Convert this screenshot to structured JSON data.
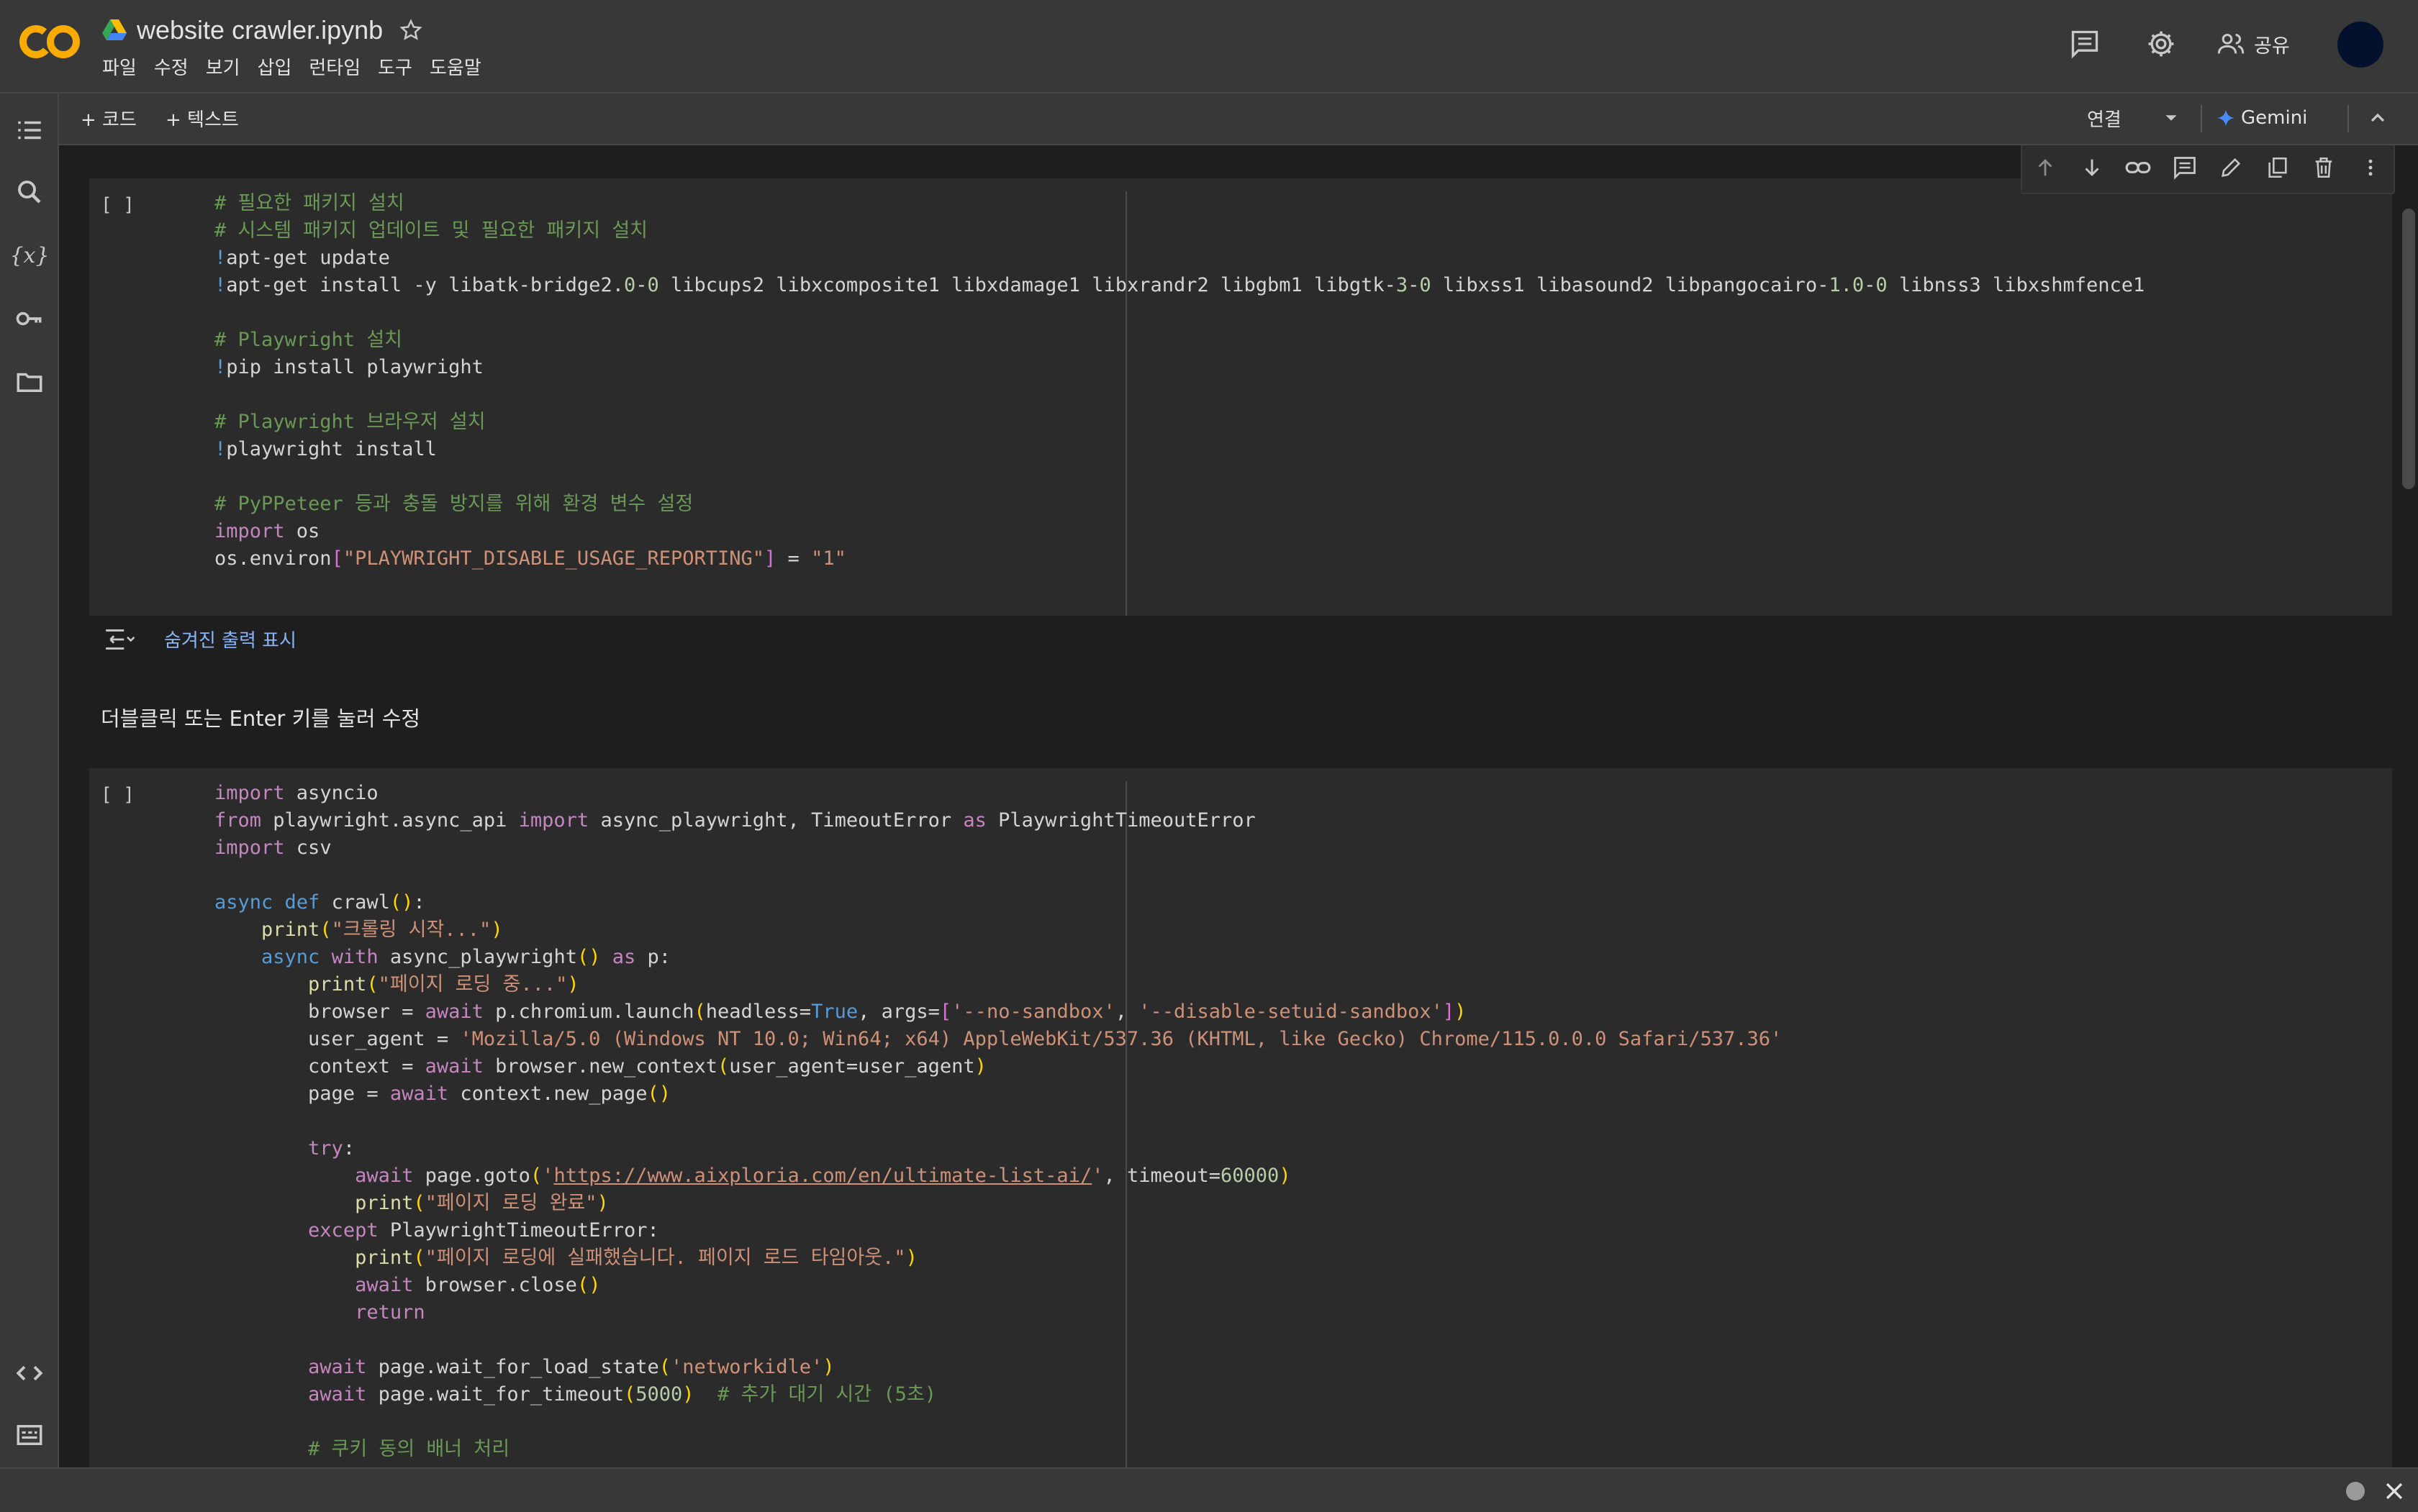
{
  "app": {
    "notebook_title": "website crawler.ipynb",
    "menu": [
      "파일",
      "수정",
      "보기",
      "삽입",
      "런타임",
      "도구",
      "도움말"
    ],
    "share_label": "공유",
    "colors": {
      "accent_orange": "#f9ab00",
      "link_blue": "#8ab4f8"
    }
  },
  "toolbar": {
    "add_code_label": "+ 코드",
    "add_text_label": "+ 텍스트",
    "connect_label": "연결",
    "gemini_label": "Gemini"
  },
  "cell1": {
    "bracket": "[ ]",
    "lines": [
      "# 필요한 패키지 설치",
      "# 시스템 패키지 업데이트 및 필요한 패키지 설치",
      "!apt-get update",
      "!apt-get install -y libatk-bridge2.0-0 libcups2 libxcomposite1 libxdamage1 libxrandr2 libgbm1 libgtk-3-0 libxss1 libasound2 libpangocairo-1.0-0 libnss3 libxshmfence1",
      "",
      "# Playwright 설치",
      "!pip install playwright",
      "",
      "# Playwright 브라우저 설치",
      "!playwright install",
      "",
      "# PyPPeteer 등과 충돌 방지를 위해 환경 변수 설정",
      "import os",
      "os.environ[\"PLAYWRIGHT_DISABLE_USAGE_REPORTING\"] = \"1\""
    ]
  },
  "hidden_output_label": "숨겨진 출력 표시",
  "text_cell_hint": "더블클릭 또는 Enter 키를 눌러 수정",
  "cell2": {
    "bracket": "[ ]",
    "lines": [
      "import asyncio",
      "from playwright.async_api import async_playwright, TimeoutError as PlaywrightTimeoutError",
      "import csv",
      "",
      "async def crawl():",
      "    print(\"크롤링 시작...\")",
      "    async with async_playwright() as p:",
      "        print(\"페이지 로딩 중...\")",
      "        browser = await p.chromium.launch(headless=True, args=['--no-sandbox', '--disable-setuid-sandbox'])",
      "        user_agent = 'Mozilla/5.0 (Windows NT 10.0; Win64; x64) AppleWebKit/537.36 (KHTML, like Gecko) Chrome/115.0.0.0 Safari/537.36'",
      "        context = await browser.new_context(user_agent=user_agent)",
      "        page = await context.new_page()",
      "",
      "        try:",
      "            await page.goto('https://www.aixploria.com/en/ultimate-list-ai/', timeout=60000)",
      "            print(\"페이지 로딩 완료\")",
      "        except PlaywrightTimeoutError:",
      "            print(\"페이지 로딩에 실패했습니다. 페이지 로드 타임아웃.\")",
      "            await browser.close()",
      "            return",
      "",
      "        await page.wait_for_load_state('networkidle')",
      "        await page.wait_for_timeout(5000)  # 추가 대기 시간 (5초)",
      "",
      "        # 쿠키 동의 배너 처리"
    ]
  },
  "icons": {
    "rail": [
      "toc-icon",
      "search-icon",
      "variables-icon",
      "key-icon",
      "folder-icon",
      "code-snippets-icon",
      "terminal-icon"
    ],
    "header": [
      "comment-icon",
      "settings-icon",
      "people-icon"
    ],
    "cell_toolbar": [
      "move-up-icon",
      "move-down-icon",
      "link-icon",
      "comment-icon",
      "edit-icon",
      "mirror-cell-icon",
      "delete-icon",
      "more-icon"
    ]
  }
}
